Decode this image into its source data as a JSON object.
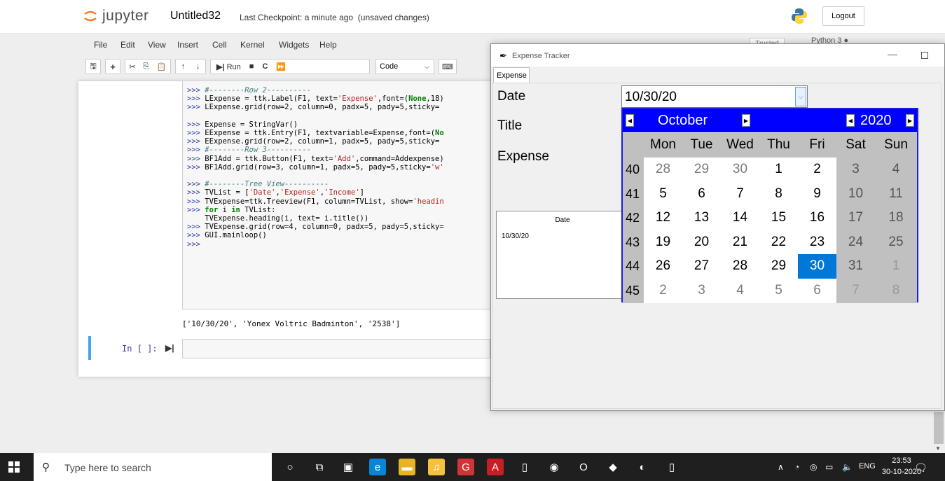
{
  "jupyter": {
    "logo_text": "jupyter",
    "notebook_name": "Untitled32",
    "checkpoint": "Last Checkpoint: a minute ago",
    "unsaved": "(unsaved changes)",
    "logout": "Logout",
    "trusted": "Trusted",
    "kernel": "Python 3",
    "menu": [
      "File",
      "Edit",
      "View",
      "Insert",
      "Cell",
      "Kernel",
      "Widgets",
      "Help"
    ],
    "toolbar": {
      "run_label": "Run",
      "cell_type": "Code"
    },
    "code_lines": [
      {
        "prompt": ">>> ",
        "parts": [
          {
            "t": "#--------Row 2----------",
            "c": "comment"
          }
        ]
      },
      {
        "prompt": ">>> ",
        "parts": [
          {
            "t": "LExpense = ttk.Label(F1, text=",
            "c": ""
          },
          {
            "t": "'Expense'",
            "c": "str"
          },
          {
            "t": ",font=(",
            "c": ""
          },
          {
            "t": "None",
            "c": "kw"
          },
          {
            "t": ",18)",
            "c": ""
          }
        ]
      },
      {
        "prompt": ">>> ",
        "parts": [
          {
            "t": "LExpense.grid(row=2, column=0, padx=5, pady=5,sticky=",
            "c": ""
          }
        ]
      },
      {
        "prompt": "",
        "parts": []
      },
      {
        "prompt": ">>> ",
        "parts": [
          {
            "t": "Expense = StringVar()",
            "c": ""
          }
        ]
      },
      {
        "prompt": ">>> ",
        "parts": [
          {
            "t": "EExpense = ttk.Entry(F1, textvariable=Expense,font=(",
            "c": ""
          },
          {
            "t": "No",
            "c": "kw"
          }
        ]
      },
      {
        "prompt": ">>> ",
        "parts": [
          {
            "t": "EExpense.grid(row=2, column=1, padx=5, pady=5,sticky=",
            "c": ""
          }
        ]
      },
      {
        "prompt": ">>> ",
        "parts": [
          {
            "t": "#--------Row 3----------",
            "c": "comment"
          }
        ]
      },
      {
        "prompt": ">>> ",
        "parts": [
          {
            "t": "BF1Add = ttk.Button(F1, text=",
            "c": ""
          },
          {
            "t": "'Add'",
            "c": "str"
          },
          {
            "t": ",command=Addexpense)",
            "c": ""
          }
        ]
      },
      {
        "prompt": ">>> ",
        "parts": [
          {
            "t": "BF1Add.grid(row=3, column=1, padx=5, pady=5,sticky=",
            "c": ""
          },
          {
            "t": "'w'",
            "c": "str"
          }
        ]
      },
      {
        "prompt": "",
        "parts": []
      },
      {
        "prompt": ">>> ",
        "parts": [
          {
            "t": "#--------Tree View----------",
            "c": "comment"
          }
        ]
      },
      {
        "prompt": ">>> ",
        "parts": [
          {
            "t": "TVList = [",
            "c": ""
          },
          {
            "t": "'Date'",
            "c": "str"
          },
          {
            "t": ",",
            "c": ""
          },
          {
            "t": "'Expense'",
            "c": "str"
          },
          {
            "t": ",",
            "c": ""
          },
          {
            "t": "'Income'",
            "c": "str"
          },
          {
            "t": "]",
            "c": ""
          }
        ]
      },
      {
        "prompt": ">>> ",
        "parts": [
          {
            "t": "TVExpense=ttk.Treeview(F1, column=TVList, show=",
            "c": ""
          },
          {
            "t": "'headin",
            "c": "str"
          }
        ]
      },
      {
        "prompt": ">>> ",
        "parts": [
          {
            "t": "for",
            "c": "kw"
          },
          {
            "t": " i ",
            "c": ""
          },
          {
            "t": "in",
            "c": "kw"
          },
          {
            "t": " TVList:",
            "c": ""
          }
        ]
      },
      {
        "prompt": "",
        "parts": [
          {
            "t": "    TVExpense.heading(i, text= i.title())",
            "c": ""
          }
        ]
      },
      {
        "prompt": ">>> ",
        "parts": [
          {
            "t": "TVExpense.grid(row=4, column=0, padx=5, pady=5,sticky=",
            "c": ""
          }
        ]
      },
      {
        "prompt": ">>> ",
        "parts": [
          {
            "t": "GUI.mainloop()",
            "c": ""
          }
        ]
      },
      {
        "prompt": ">>>",
        "parts": []
      }
    ],
    "output": "['10/30/20', 'Yonex Voltric Badminton', '2538']",
    "next_prompt": "In [ ]:"
  },
  "tk": {
    "window_title": "Expense Tracker",
    "tab": "Expense",
    "labels": {
      "date": "Date",
      "title": "Title",
      "expense": "Expense"
    },
    "date_value": "10/30/20",
    "tree_header": "Date",
    "tree_row": "10/30/20"
  },
  "calendar": {
    "month": "October",
    "year": "2020",
    "days_of_week": [
      "Mon",
      "Tue",
      "Wed",
      "Thu",
      "Fri",
      "Sat",
      "Sun"
    ],
    "weeks": [
      {
        "num": "40",
        "days": [
          {
            "d": "28",
            "o": true
          },
          {
            "d": "29",
            "o": true
          },
          {
            "d": "30",
            "o": true
          },
          {
            "d": "1"
          },
          {
            "d": "2"
          },
          {
            "d": "3"
          },
          {
            "d": "4"
          }
        ]
      },
      {
        "num": "41",
        "days": [
          {
            "d": "5"
          },
          {
            "d": "6"
          },
          {
            "d": "7"
          },
          {
            "d": "8"
          },
          {
            "d": "9"
          },
          {
            "d": "10"
          },
          {
            "d": "11"
          }
        ]
      },
      {
        "num": "42",
        "days": [
          {
            "d": "12"
          },
          {
            "d": "13"
          },
          {
            "d": "14"
          },
          {
            "d": "15"
          },
          {
            "d": "16"
          },
          {
            "d": "17"
          },
          {
            "d": "18"
          }
        ]
      },
      {
        "num": "43",
        "days": [
          {
            "d": "19"
          },
          {
            "d": "20"
          },
          {
            "d": "21"
          },
          {
            "d": "22"
          },
          {
            "d": "23"
          },
          {
            "d": "24"
          },
          {
            "d": "25"
          }
        ]
      },
      {
        "num": "44",
        "days": [
          {
            "d": "26"
          },
          {
            "d": "27"
          },
          {
            "d": "28"
          },
          {
            "d": "29"
          },
          {
            "d": "30",
            "s": true
          },
          {
            "d": "31"
          },
          {
            "d": "1",
            "o": true
          }
        ]
      },
      {
        "num": "45",
        "days": [
          {
            "d": "2",
            "o": true
          },
          {
            "d": "3",
            "o": true
          },
          {
            "d": "4",
            "o": true
          },
          {
            "d": "5",
            "o": true
          },
          {
            "d": "6",
            "o": true
          },
          {
            "d": "7",
            "o": true
          },
          {
            "d": "8",
            "o": true
          }
        ]
      }
    ],
    "colors": {
      "header": "#0000ff",
      "selected": "#0078d7",
      "weekend": "#c0c0c0"
    }
  },
  "taskbar": {
    "search_placeholder": "Type here to search",
    "language": "ENG",
    "time": "23:53",
    "date": "30-10-2020",
    "notify_count": "1",
    "apps": [
      {
        "name": "cortana-icon",
        "glyph": "○",
        "bg": "transparent"
      },
      {
        "name": "task-view-icon",
        "glyph": "⧉",
        "bg": "transparent"
      },
      {
        "name": "store-icon",
        "glyph": "▣",
        "bg": "transparent"
      },
      {
        "name": "edge-icon",
        "glyph": "e",
        "bg": "#0a84d6"
      },
      {
        "name": "file-explorer-icon",
        "glyph": "▬",
        "bg": "#e9b424"
      },
      {
        "name": "player-icon",
        "glyph": "♫",
        "bg": "#f6c23e"
      },
      {
        "name": "game-icon",
        "glyph": "G",
        "bg": "#d13438"
      },
      {
        "name": "acrobat-icon",
        "glyph": "A",
        "bg": "#c81d25"
      },
      {
        "name": "file-icon",
        "glyph": "▯",
        "bg": "transparent"
      },
      {
        "name": "chrome-icon",
        "glyph": "◉",
        "bg": "transparent"
      },
      {
        "name": "opera-icon",
        "glyph": "O",
        "bg": "transparent"
      },
      {
        "name": "python-icon",
        "glyph": "◆",
        "bg": "transparent"
      },
      {
        "name": "jupyter-icon",
        "glyph": "◐",
        "bg": "transparent"
      },
      {
        "name": "document-icon",
        "glyph": "▯",
        "bg": "transparent"
      }
    ]
  }
}
